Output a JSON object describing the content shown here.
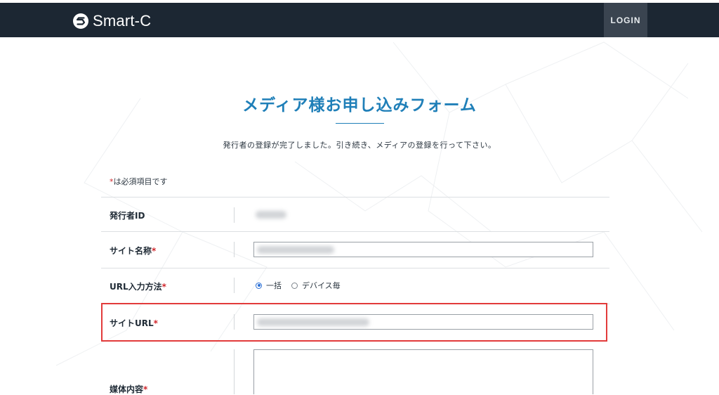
{
  "header": {
    "brand": "Smart-C",
    "login_label": "LOGIN"
  },
  "main": {
    "title": "メディア様お申し込みフォーム",
    "notice": "発行者の登録が完了しました。引き続き、メディアの登録を行って下さい。",
    "required_note_mark": "*",
    "required_note_text": "は必須項目です"
  },
  "form": {
    "publisher_id_label": "発行者ID",
    "site_name_label": "サイト名称",
    "url_method_label": "URL入力方法",
    "url_method_options": [
      "一括",
      "デバイス毎"
    ],
    "url_method_selected": "一括",
    "site_url_label": "サイトURL",
    "media_content_label": "媒体内容",
    "required_mark": "*"
  },
  "colors": {
    "topbar": "#1c2733",
    "accent": "#1f7fb8",
    "required": "#d0262b",
    "highlight": "#e23b3b"
  }
}
